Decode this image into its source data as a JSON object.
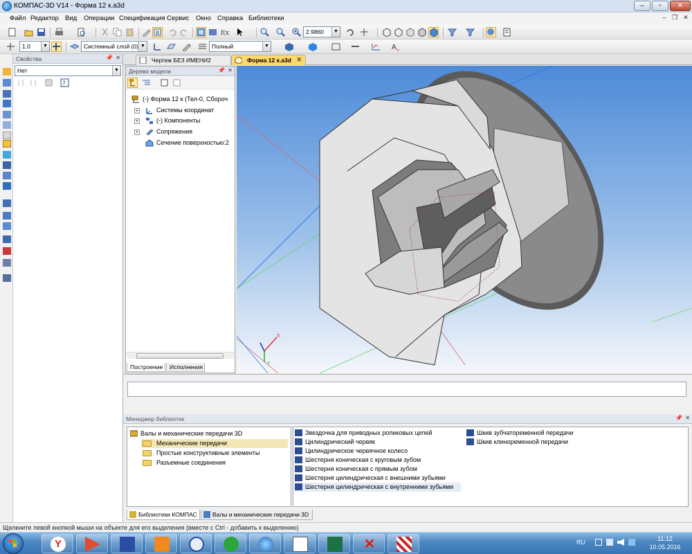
{
  "window": {
    "title": "КОМПАС-3D V14 - Форма 12 к.а3d"
  },
  "menu": [
    "Файл",
    "Редактор",
    "Вид",
    "Операции",
    "Спецификация",
    "Сервис",
    "Окно",
    "Справка",
    "Библиотеки"
  ],
  "toolbar": {
    "zoom_value": "2.9860"
  },
  "toolbar2": {
    "step_value": "1.0",
    "layer_value": "Системный слой (0)",
    "mode_value": "Полный"
  },
  "properties": {
    "header": "Свойства",
    "select_value": "Нет"
  },
  "tabs": [
    {
      "label": "Чертеж БЕЗ ИМЕНИ2",
      "active": false
    },
    {
      "label": "Форма 12 к.а3d",
      "active": true
    }
  ],
  "tree": {
    "header": "Дерево модели",
    "items": [
      {
        "label": "(-) Форма 12 к (Тел-0, Сбороч",
        "icon": "model-root-icon"
      },
      {
        "label": "Системы координат",
        "icon": "coordinate-systems-icon"
      },
      {
        "label": "(-) Компоненты",
        "icon": "components-icon"
      },
      {
        "label": "Сопряжения",
        "icon": "mates-icon"
      },
      {
        "label": "Сечение поверхностью:2",
        "icon": "section-icon"
      }
    ],
    "tabs": [
      "Построение",
      "Исполнения"
    ]
  },
  "library": {
    "header": "Менеджер библиотек",
    "root": "Валы и механические передачи 3D",
    "folders": [
      "Механические передачи",
      "Простые конструктивные элементы",
      "Разъемные соединения"
    ],
    "items_col1": [
      "Звездочка для приводных роликовых цепей",
      "Цилиндрический червяк",
      "Цилиндрическое червячное колесо",
      "Шестерня коническая с круговым зубом",
      "Шестерня коническая с прямым зубом",
      "Шестерня цилиндрическая с внешними зубьями",
      "Шестерня цилиндрическая с внутренними зубьями"
    ],
    "items_col2": [
      "Шкив зубчатоременной передачи",
      "Шкив клиноременной передачи"
    ],
    "tabs": [
      "Библиотеки КОМПАС",
      "Валы и механические передачи 3D"
    ]
  },
  "status": {
    "text": "Щелкните левой кнопкой мыши на объекте для его выделения (вместе с Ctrl - добавить к выделению)"
  },
  "taskbar": {
    "lang": "RU",
    "time": "11:12",
    "date": "10.05.2016",
    "apps": [
      "yandex-browser-icon",
      "media-player-icon",
      "save-disk-icon",
      "outlook-icon",
      "volkswagen-icon",
      "app-green-icon",
      "kompas-icon",
      "document-icon",
      "excel-icon",
      "x-red-icon",
      "chess-icon"
    ]
  },
  "colors": {
    "accent": "#ffd86b",
    "viewport_top": "#4d8ad8",
    "viewport_bottom": "#f5f7fb"
  }
}
